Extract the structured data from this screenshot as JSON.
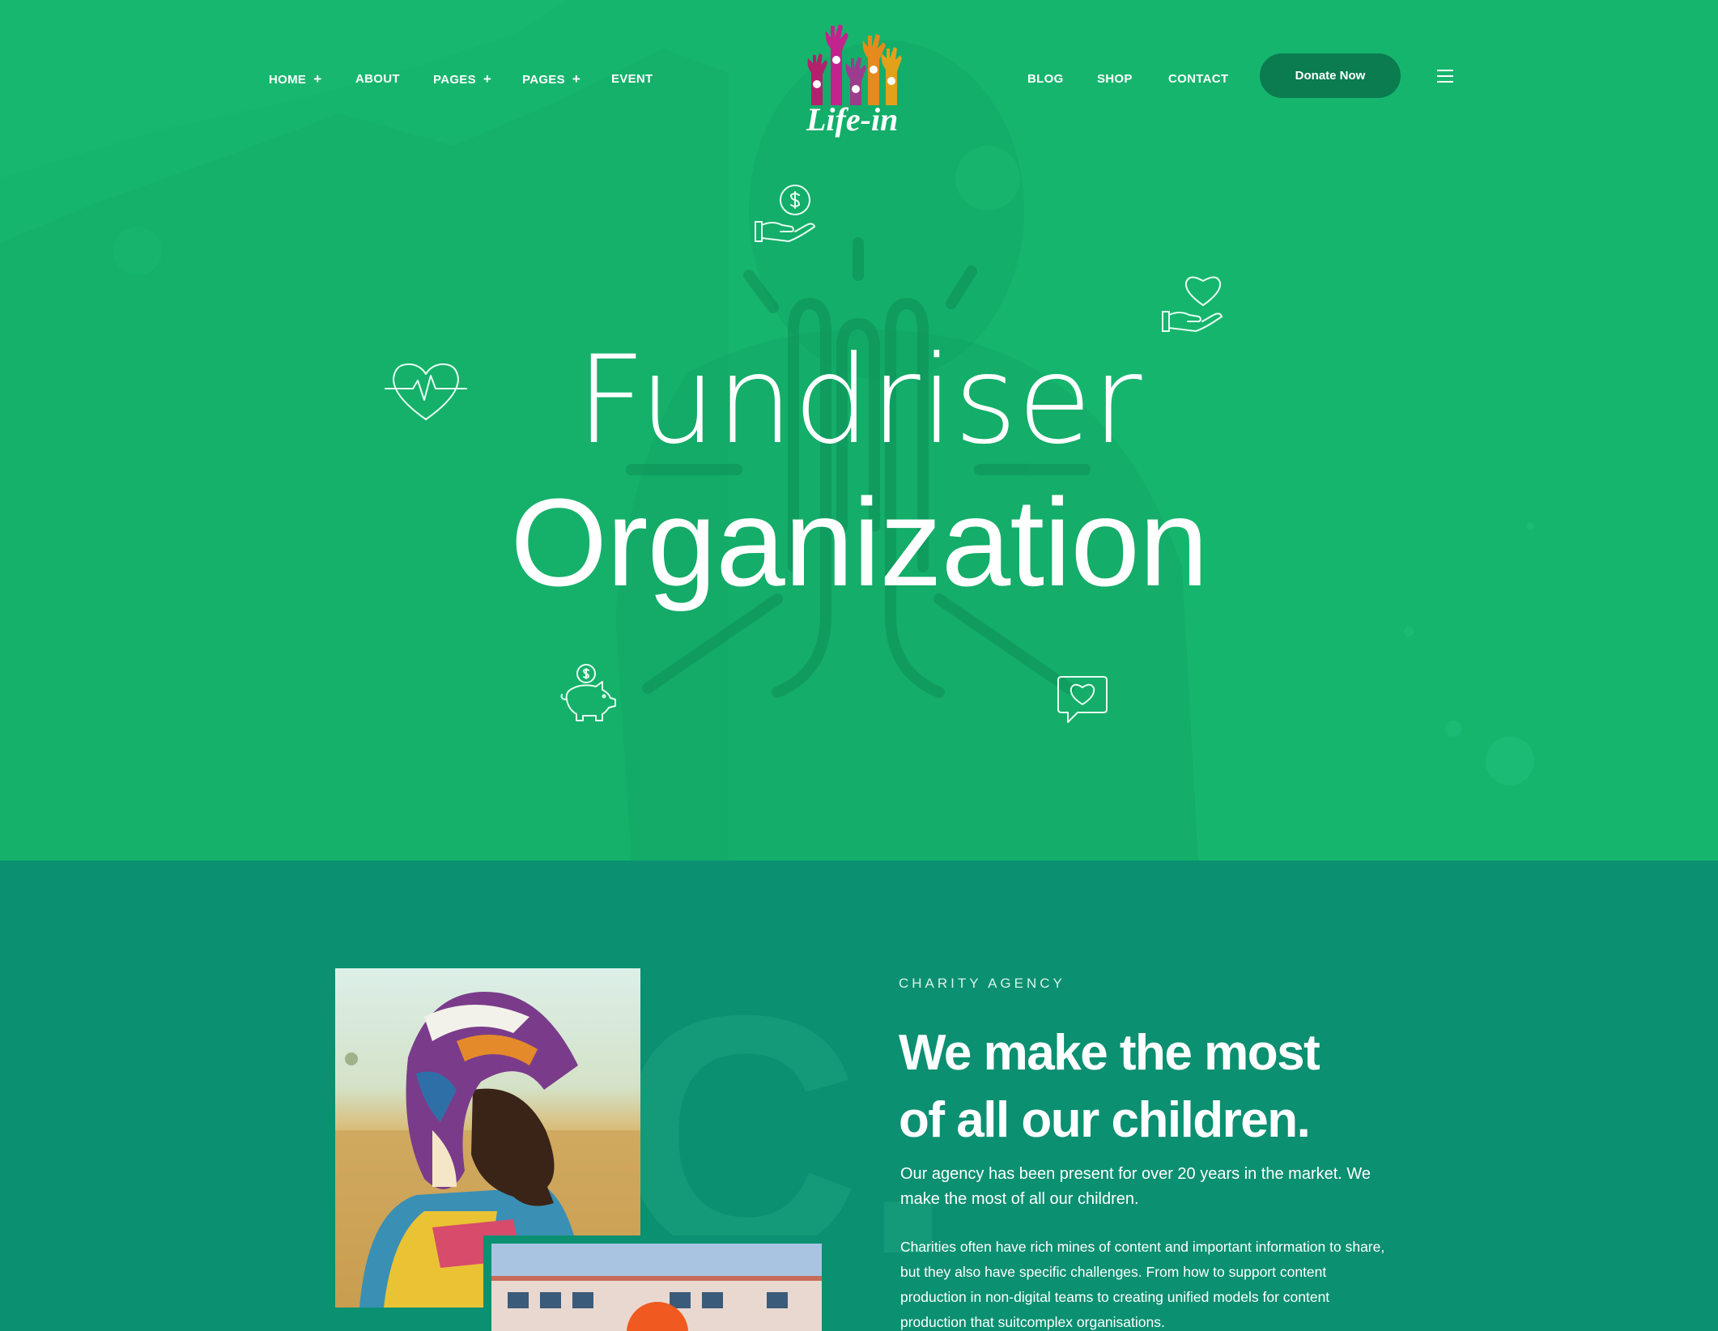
{
  "nav": {
    "left": [
      {
        "label": "HOME",
        "plus": "+"
      },
      {
        "label": "ABOUT",
        "plus": ""
      },
      {
        "label": "PAGES",
        "plus": "+"
      },
      {
        "label": "PAGES",
        "plus": "+"
      },
      {
        "label": "EVENT",
        "plus": ""
      }
    ],
    "right": [
      {
        "label": "BLOG"
      },
      {
        "label": "SHOP"
      },
      {
        "label": "CONTACT"
      }
    ],
    "donate_label": "Donate Now"
  },
  "logo": {
    "text": "Life-in"
  },
  "hero": {
    "line1": "Fundriser",
    "line2": "Organization"
  },
  "about": {
    "eyebrow": "CHARITY AGENCY",
    "title_line1": "We make the most",
    "title_line2": "of all our children.",
    "lead": "Our agency has been present for over 20 years in the market. We make the most of all our children.",
    "body": "Charities often have rich mines of content and important information to share, but they also have specific challenges. From how to support content production in non-digital teams to creating unified models for content production that suitcomplex organisations.",
    "big_letter": "C."
  },
  "colors": {
    "hero_green": "#16b56d",
    "section_green": "#0b9071",
    "button_green": "#0b7b50",
    "accent_orange": "#f0591f"
  },
  "icons": [
    "dollar-hand-icon",
    "heart-hand-icon",
    "heartbeat-icon",
    "piggy-bank-icon",
    "heart-chat-icon",
    "menu-icon"
  ]
}
